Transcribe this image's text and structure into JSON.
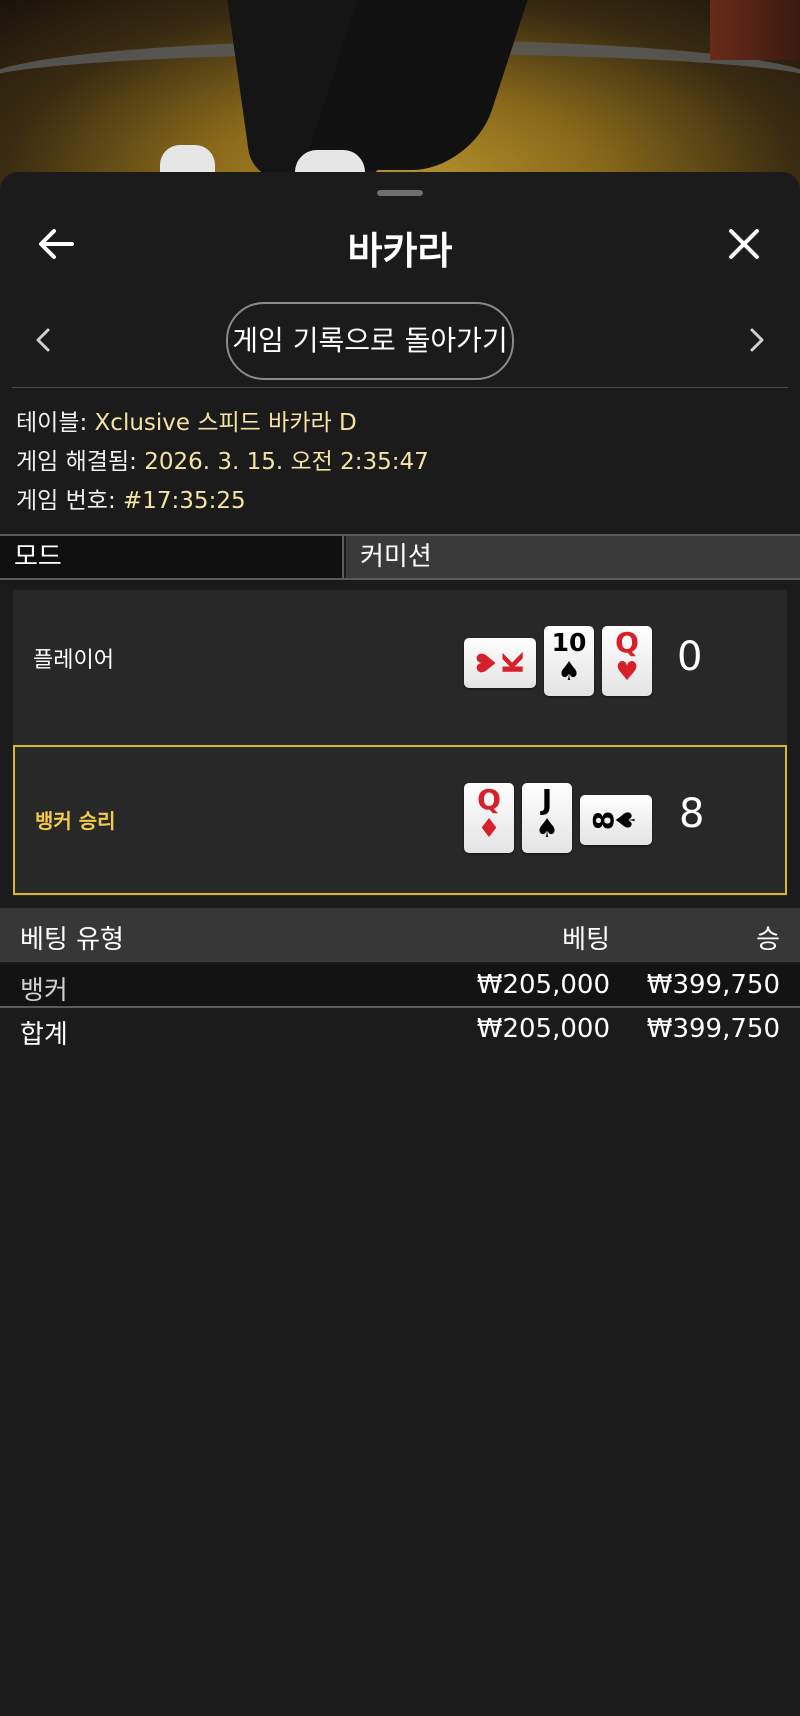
{
  "header": {
    "title": "바카라"
  },
  "navigation": {
    "history_button": "게임 기록으로 돌아가기"
  },
  "game_info": {
    "table_label": "테이블:",
    "table_value": "Xclusive 스피드 바카라 D",
    "resolved_label": "게임 해결됨:",
    "resolved_value": "2026. 3. 15. 오전 2:35:47",
    "number_label": "게임 번호:",
    "number_value": "#17:35:25"
  },
  "mode": {
    "label": "모드",
    "value": "커미션"
  },
  "hands": {
    "player": {
      "label": "플레이어",
      "score": "0",
      "cards": [
        {
          "rank": "K",
          "suit": "♥",
          "color": "red",
          "orientation": "horizontal"
        },
        {
          "rank": "10",
          "suit": "♠",
          "color": "black",
          "orientation": "vertical"
        },
        {
          "rank": "Q",
          "suit": "♥",
          "color": "red",
          "orientation": "vertical"
        }
      ]
    },
    "banker": {
      "label": "뱅커 승리",
      "score": "8",
      "cards": [
        {
          "rank": "Q",
          "suit": "♦",
          "color": "red",
          "orientation": "vertical"
        },
        {
          "rank": "J",
          "suit": "♠",
          "color": "black",
          "orientation": "vertical"
        },
        {
          "rank": "8",
          "suit": "♠",
          "color": "black",
          "orientation": "horizontal"
        }
      ]
    },
    "winner_highlight_color": "#d9b52a"
  },
  "bets": {
    "headers": {
      "type": "베팅 유형",
      "bet": "베팅",
      "win": "승"
    },
    "rows": [
      {
        "type": "뱅커",
        "bet": "₩205,000",
        "win": "₩399,750"
      }
    ],
    "total": {
      "type": "합계",
      "bet": "₩205,000",
      "win": "₩399,750"
    }
  },
  "colors": {
    "accent_value": "#f4e3a2",
    "background": "#1b1b1b"
  },
  "icons": {
    "back": "arrow-left-icon",
    "close": "close-icon",
    "prev": "chevron-left-icon",
    "next": "chevron-right-icon"
  }
}
